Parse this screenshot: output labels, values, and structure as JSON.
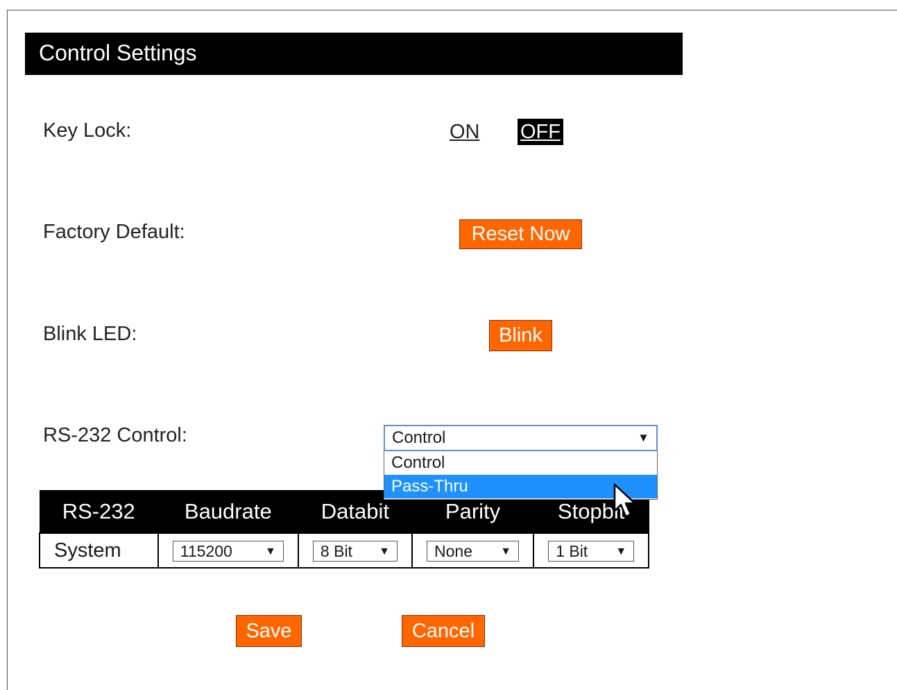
{
  "page": {
    "title": "Control Settings"
  },
  "key_lock": {
    "label": "Key Lock:",
    "on_label": "ON",
    "off_label": "OFF",
    "selected": "OFF"
  },
  "factory_default": {
    "label": "Factory Default:",
    "button_label": "Reset Now"
  },
  "blink_led": {
    "label": "Blink LED:",
    "button_label": "Blink"
  },
  "rs232_control": {
    "label": "RS-232 Control:",
    "selected_value": "Control",
    "options": [
      "Control",
      "Pass-Thru"
    ],
    "highlighted_option": "Pass-Thru"
  },
  "rs232_table": {
    "headers": [
      "RS-232",
      "Baudrate",
      "Databit",
      "Parity",
      "Stopbit"
    ],
    "row": {
      "name": "System",
      "baudrate": "115200",
      "databit": "8 Bit",
      "parity": "None",
      "stopbit": "1 Bit"
    }
  },
  "actions": {
    "save_label": "Save",
    "cancel_label": "Cancel"
  },
  "colors": {
    "accent": "#ff6600",
    "header_bg": "#000000",
    "dropdown_highlight": "#1e90ff",
    "select_focus_border": "#5b8fd9"
  }
}
